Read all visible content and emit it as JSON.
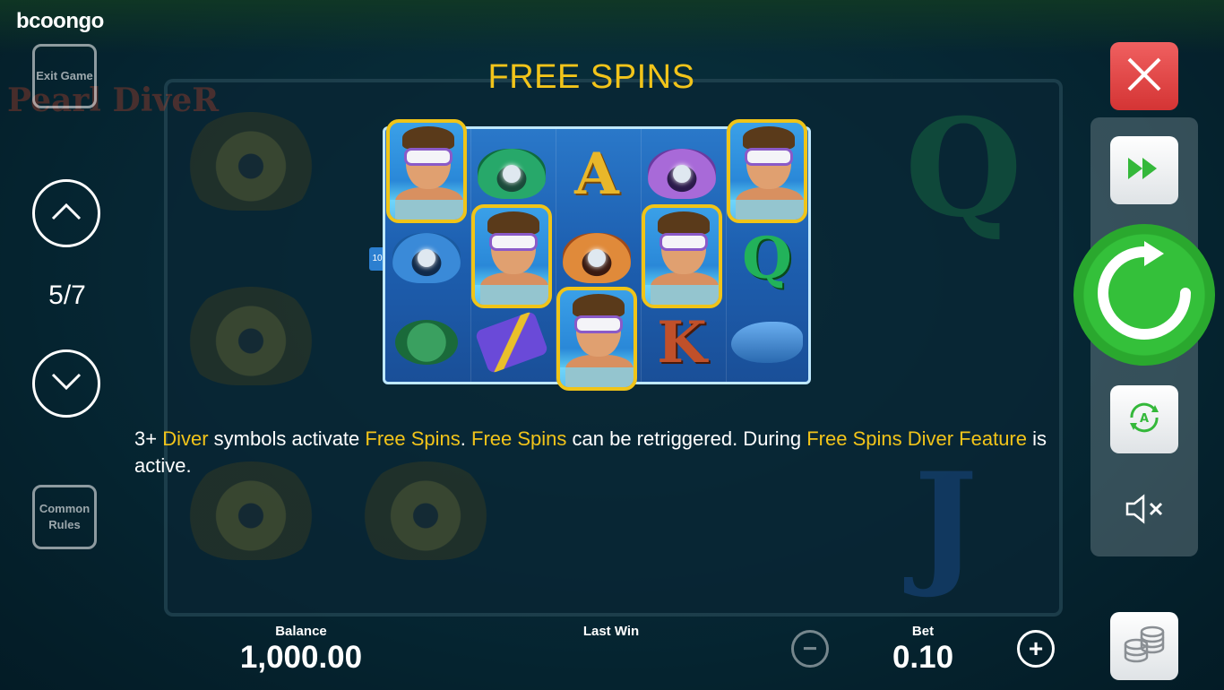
{
  "brand": {
    "name": "bcoongo",
    "game_logo": "Pearl DiveR"
  },
  "left_controls": {
    "exit_label": "Exit Game",
    "up_icon": "chevron-up-icon",
    "down_icon": "chevron-down-icon",
    "page_indicator": "5/7",
    "common_rules_label": "Common Rules"
  },
  "paytable": {
    "title": "FREE SPINS",
    "payline_number": "10",
    "description": {
      "t1": "3+ ",
      "t2": "Diver",
      "t3": " symbols activate ",
      "t4": "Free Spins",
      "t5": ". ",
      "t6": "Free Spins",
      "t7": " can be retriggered. During ",
      "t8": "Free Spins Diver Feature",
      "t9": " is active."
    },
    "mini_board_symbols": [
      [
        "diver",
        "clam-blue",
        "turtle"
      ],
      [
        "clam-green",
        "diver",
        "flippers"
      ],
      [
        "A",
        "clam-orange",
        "diver"
      ],
      [
        "clam-purple",
        "diver",
        "K"
      ],
      [
        "diver",
        "Q",
        "dolphin"
      ]
    ],
    "highlight_color": "#f2c41a"
  },
  "right_controls": {
    "close_icon": "close-icon",
    "turbo_icon": "fast-forward-icon",
    "spin_icon": "spin-icon",
    "autoplay_icon": "autoplay-icon",
    "sound_icon": "sound-muted-icon",
    "bet_menu_icon": "coins-icon",
    "spin_color": "#34c03a",
    "close_color": "#e04848"
  },
  "bottom_bar": {
    "balance_label": "Balance",
    "balance_value": "1,000.00",
    "last_win_label": "Last Win",
    "bet_label": "Bet",
    "bet_value": "0.10",
    "minus_label": "−",
    "plus_label": "+"
  }
}
